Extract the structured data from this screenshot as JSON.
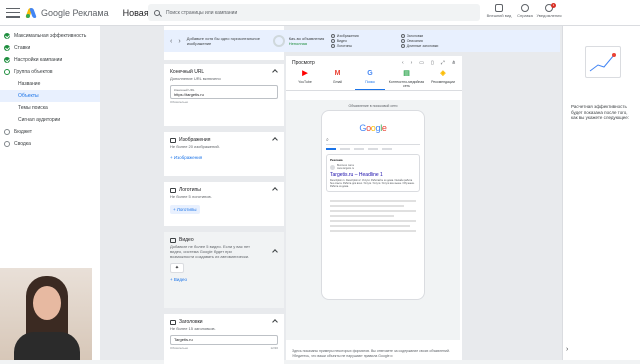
{
  "header": {
    "brand": "Google Реклама",
    "campaign_title": "Новая кампания",
    "search_placeholder": "Поиск страницы или кампании",
    "tools": [
      {
        "label": "Внешний вид",
        "icon": "appearance-icon"
      },
      {
        "label": "Справка",
        "icon": "help-icon"
      },
      {
        "label": "Уведомле­ния",
        "icon": "bell-icon",
        "badge": "1"
      }
    ]
  },
  "sidebar": {
    "items": [
      {
        "label": "Максимальная эффективность",
        "state": "done"
      },
      {
        "label": "Ставки",
        "state": "done"
      },
      {
        "label": "Настройки кампании",
        "state": "done"
      },
      {
        "label": "Группа объектов",
        "state": "active"
      },
      {
        "label": "Бюджет",
        "state": "empty"
      },
      {
        "label": "Сводка",
        "state": "empty"
      }
    ],
    "subitems": [
      "Название",
      "Объекты",
      "Темы поиска",
      "Сигнал аудитории"
    ],
    "active_subitem": "Объекты"
  },
  "banner": {
    "message": "Добавьте хотя бы одно горизонтальное изображение",
    "quality_label": "Кач-во объявления",
    "quality_value": "Неполная",
    "checks": [
      "Изображения",
      "Заголовки",
      "Видео",
      "Описания",
      "Логотипы",
      "Длинные заголовки"
    ]
  },
  "form": {
    "final_url": {
      "title": "Конечный URL",
      "subtitle": "Дополнение URL включено",
      "field_label": "Конечный URL",
      "value": "https://targetis.ru",
      "hint": "Обязательно"
    },
    "images": {
      "title": "Изображения",
      "subtitle": "Не более 20 изображений.",
      "add_label": "Изображения"
    },
    "logos": {
      "title": "Логотипы",
      "subtitle": "Не более 5 логотипов.",
      "add_label": "Логотипы"
    },
    "videos": {
      "title": "Видео",
      "subtitle": "Добавьте не более 5 видео. Если у вас нет видео, система Google будет при возможности создавать их автоматически.",
      "add_label": "Видео"
    },
    "headlines": {
      "title": "Заголовки",
      "subtitle": "Не более 15 заголовков.",
      "value": "Targetis.ru",
      "hint": "Обязательно",
      "counter": "12/30"
    }
  },
  "preview": {
    "title": "Просмотр",
    "tabs": [
      {
        "label": "YouTube",
        "glyph": "▶",
        "color": "#ff0000"
      },
      {
        "label": "Gmail",
        "glyph": "M",
        "color": "#ea4335"
      },
      {
        "label": "Поиск",
        "glyph": "G",
        "color": "#4285f4"
      },
      {
        "label": "Контекстно-медийная сеть",
        "glyph": "▤",
        "color": "#34a853"
      },
      {
        "label": "Рекомендации",
        "glyph": "◈",
        "color": "#fbbc04"
      }
    ],
    "active_tab": "Поиск",
    "caption": "Объявление в поисковой сети",
    "phone": {
      "google": [
        "G",
        "o",
        "o",
        "g",
        "l",
        "e"
      ],
      "ad_tag": "Реклама",
      "site_name": "Business name",
      "site_url": "www.targetis.ru",
      "headline": "Targetis.ru – Headline 1",
      "description": "Description 1. Description 2. Услуги. Работайте из дома. Онлайн работа без опыта. Работа для всех. Услуги. Услуги. Услуги все выше. Обучение. Работа из дома."
    },
    "footer": "Здесь показаны примеры некоторых форматов. Вы отвечаете за содержание своих объявлений. Убедитесь, что ваши объекты не нарушают правила Google и"
  },
  "right_panel": {
    "text": "Расчетная эффективность будет показана после того, как вы укажете следующее:"
  }
}
